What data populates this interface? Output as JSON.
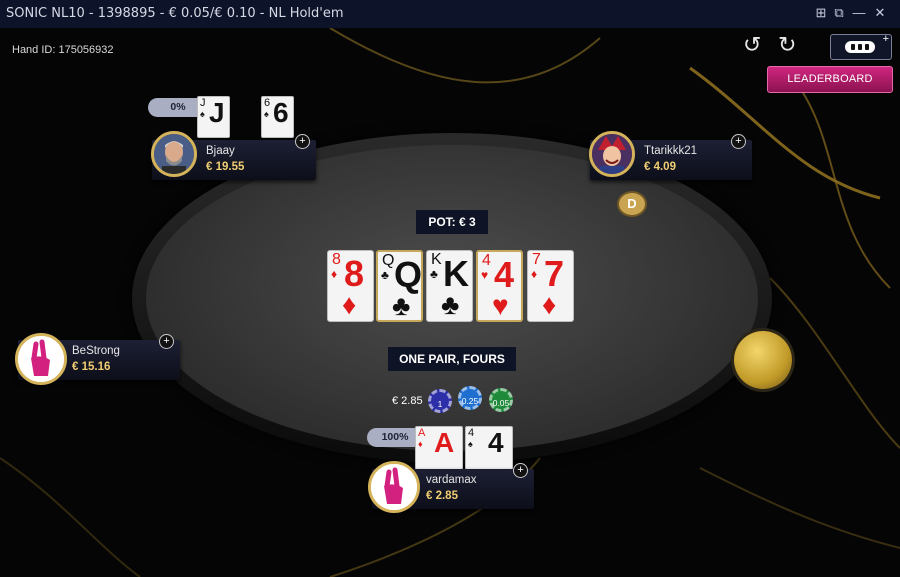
{
  "window": {
    "title": "SONIC NL10 - 1398895 - € 0.05/€ 0.10 - NL Hold'em",
    "controls": {
      "tile": "⊞",
      "restore": "⧉",
      "minimize": "—",
      "close": "✕"
    }
  },
  "hand_id": "Hand ID: 175056932",
  "toolbar": {
    "undo_icon": "↺",
    "redo_icon": "↻",
    "chat_plus": "+",
    "leaderboard_label": "LEADERBOARD"
  },
  "pot": "POT: € 3",
  "hand_rank": "ONE PAIR, FOURS",
  "board": [
    {
      "rank": "8",
      "suit": "♦",
      "color": "red",
      "selected": false
    },
    {
      "rank": "Q",
      "suit": "♣",
      "color": "blk",
      "selected": true
    },
    {
      "rank": "K",
      "suit": "♣",
      "color": "blk",
      "selected": false
    },
    {
      "rank": "4",
      "suit": "♥",
      "color": "red",
      "selected": true
    },
    {
      "rank": "7",
      "suit": "♦",
      "color": "red",
      "selected": false
    }
  ],
  "players": {
    "bjaay": {
      "name": "Bjaay",
      "stack": "€ 19.55",
      "equity": "0%",
      "cards": [
        {
          "rank": "J",
          "suit": "♠"
        },
        {
          "rank": "6",
          "suit": "♠"
        }
      ]
    },
    "ttarikkk": {
      "name": "Ttarikkk21",
      "stack": "€ 4.09"
    },
    "bestrong": {
      "name": "BeStrong",
      "stack": "€ 15.16"
    },
    "vardamax": {
      "name": "vardamax",
      "stack": "€ 2.85",
      "equity": "100%",
      "cards": [
        {
          "rank": "A",
          "suit": "♦",
          "color": "red"
        },
        {
          "rank": "4",
          "suit": "♠",
          "color": "blk"
        }
      ]
    }
  },
  "dealer_button": "D",
  "bet": {
    "amount": "€ 2.85",
    "chips": [
      {
        "label": "1",
        "color": "#2c2fa8"
      },
      {
        "label": "0.25",
        "color": "#1f6fd1"
      },
      {
        "label": "0.05",
        "color": "#1f8a3a"
      }
    ]
  }
}
